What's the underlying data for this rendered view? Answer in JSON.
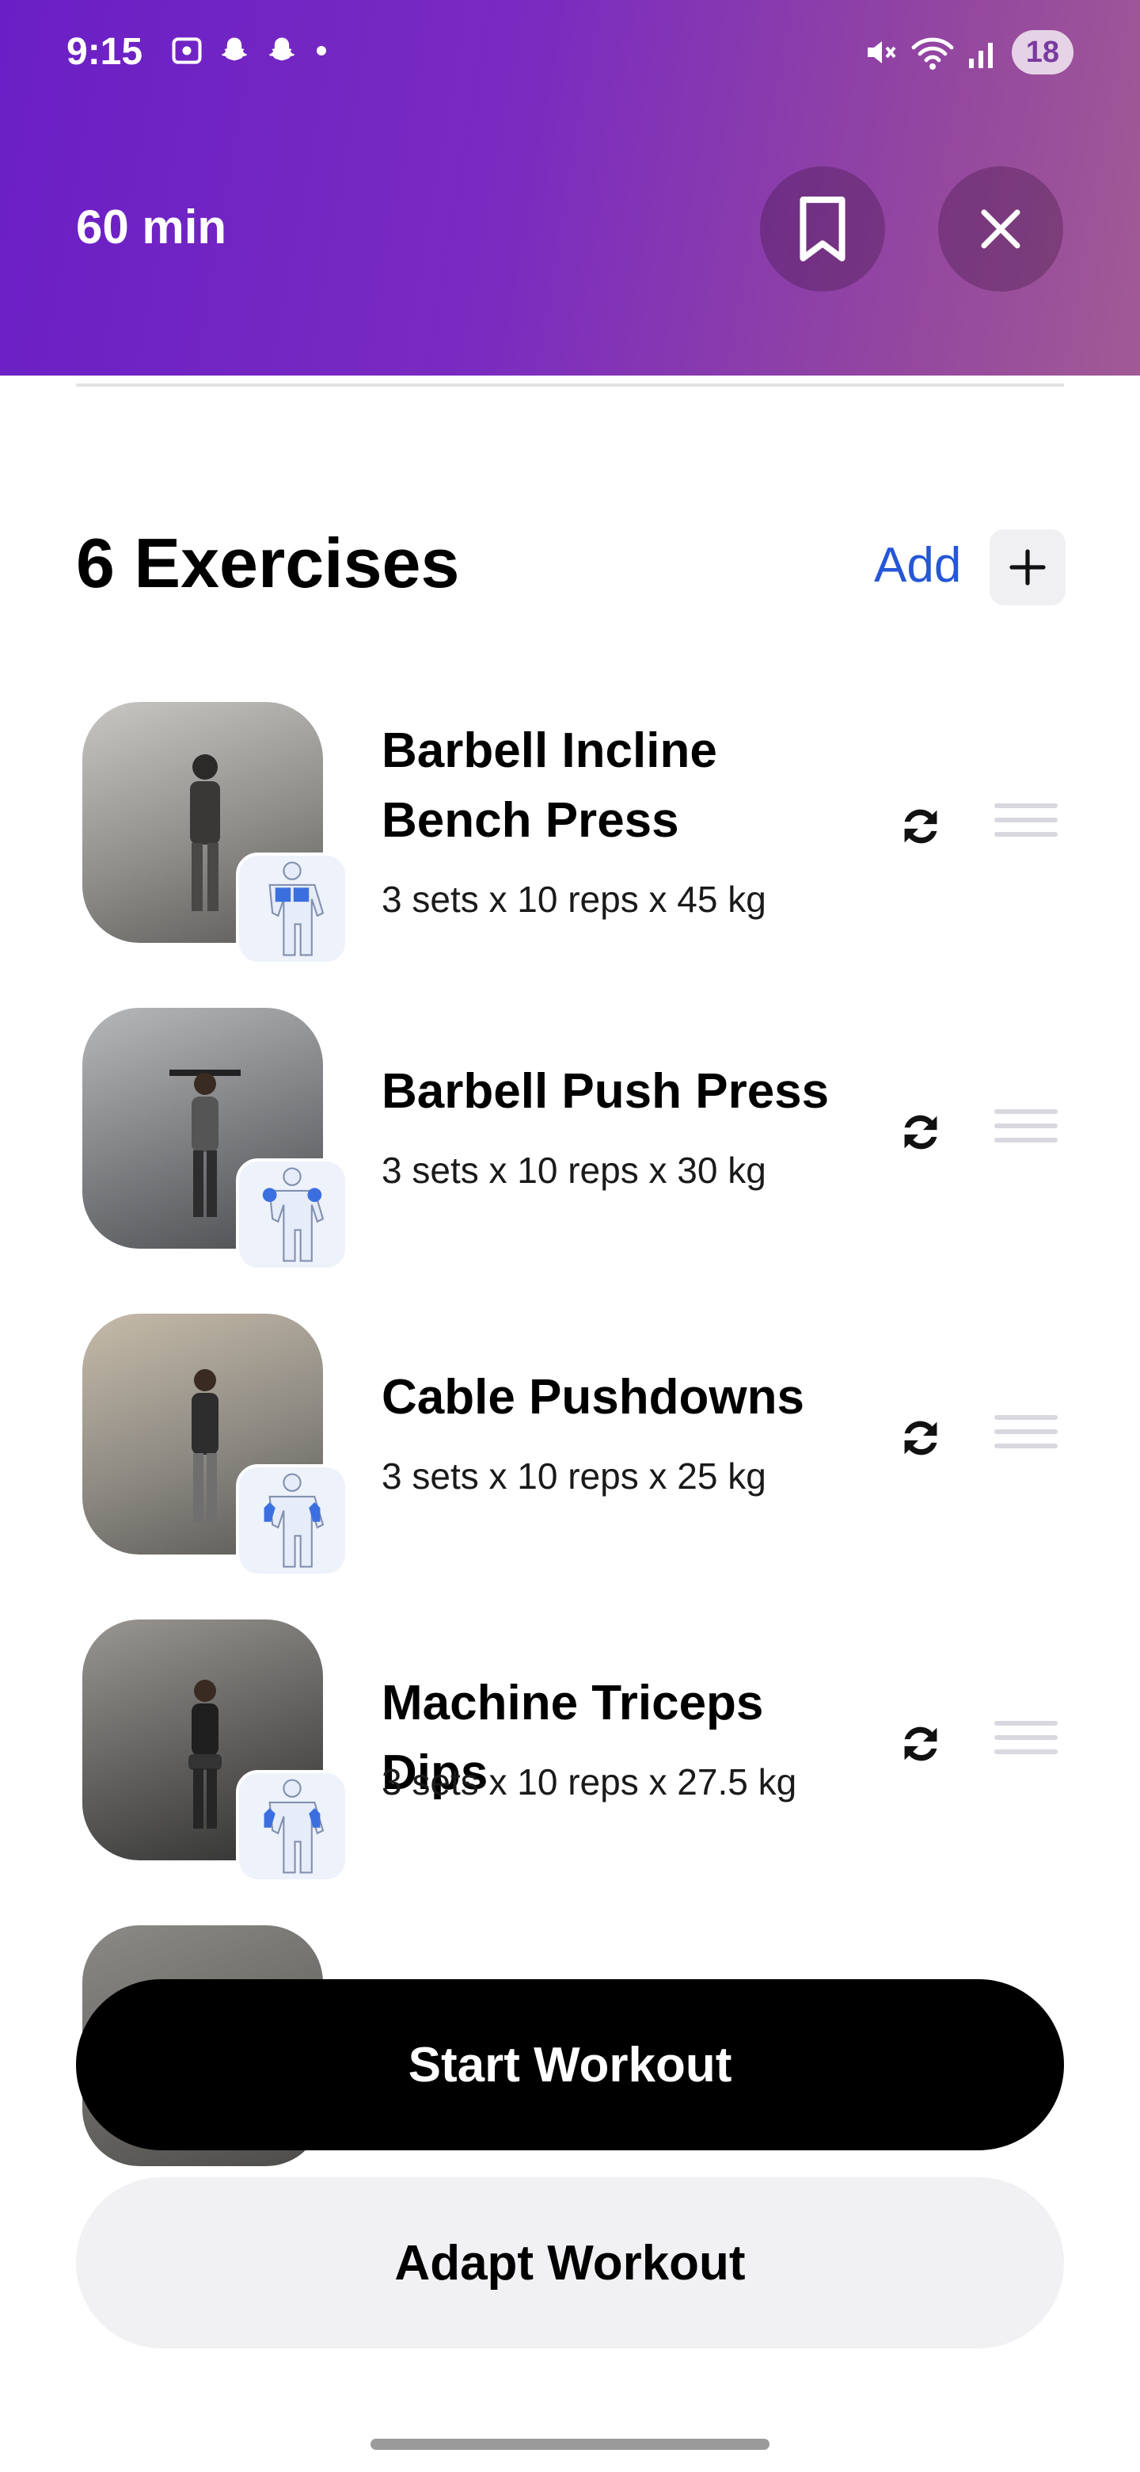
{
  "status_bar": {
    "time": "9:15",
    "battery": "18"
  },
  "header": {
    "duration": "60 min"
  },
  "section": {
    "title": "6 Exercises",
    "add_label": "Add"
  },
  "exercises": [
    {
      "name": "Barbell Incline Bench Press",
      "detail": "3 sets x 10 reps x 45 kg",
      "muscle": "chest"
    },
    {
      "name": "Barbell Push Press",
      "detail": "3 sets x 10 reps x 30 kg",
      "muscle": "shoulders"
    },
    {
      "name": "Cable Pushdowns",
      "detail": "3 sets x 10 reps x 25 kg",
      "muscle": "triceps"
    },
    {
      "name": "Machine Triceps Dips",
      "detail": "3 sets x 10 reps x 27.5 kg",
      "muscle": "triceps"
    }
  ],
  "actions": {
    "start_label": "Start Workout",
    "adapt_label": "Adapt Workout"
  },
  "colors": {
    "accent": "#2557d6",
    "muscle_highlight": "#3b6fe0",
    "header_start": "#6a1fc6",
    "header_end": "#a15a95"
  }
}
